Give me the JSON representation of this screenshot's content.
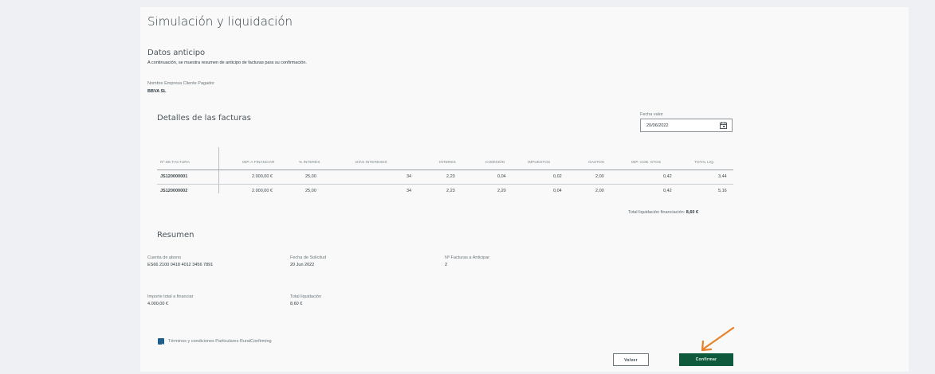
{
  "page": {
    "title": "Simulación y liquidación",
    "datos_anticipo": {
      "heading": "Datos anticipo",
      "intro": "A continuación, se muestra resumen de anticipo de facturas para su confirmación.",
      "empresa_label": "Nombre Empresa Cliente Pagador",
      "empresa_value": "BBVA SL"
    },
    "facturas": {
      "heading": "Detalles de las facturas",
      "fecha_valor_label": "Fecha valor",
      "fecha_valor_value": "20/06/2022",
      "columns": [
        "Nº DE FACTURA",
        "IMP. A FINANCIAR",
        "% INTERÉS",
        "DÍAS INTERESES",
        "INTERES",
        "COMISIÓN",
        "IMPUESTOS",
        "GASTOS",
        "IMP. COB. GTOS",
        "TOTAL LIQ."
      ],
      "rows": [
        [
          "JS120000001",
          "2.000,00 €",
          "25,00",
          "34",
          "2,23",
          "0,04",
          "0,02",
          "2,00",
          "0,42",
          "3,44"
        ],
        [
          "JS120000002",
          "2.000,00 €",
          "25,00",
          "34",
          "2,23",
          "2,20",
          "0,04",
          "2,00",
          "0,42",
          "5,16"
        ]
      ],
      "total_label": "Total liquidación financiación:",
      "total_value": "8,60 €"
    },
    "resumen": {
      "heading": "Resumen",
      "cuenta_label": "Cuenta de abono",
      "cuenta_value": "ES66 2100 0418 4012 3456 7891",
      "fecha_solicitud_label": "Fecha de Solicitud",
      "fecha_solicitud_value": "20 Jun 2022",
      "num_facturas_label": "Nº Facturas a Anticipar",
      "num_facturas_value": "2",
      "importe_label": "Importe total a financiar",
      "importe_value": "4.000,00 €",
      "total_liq_label": "Total liquidación",
      "total_liq_value": "8,60 €"
    },
    "terms_label": "Términos y condiciones Particulares RuralConfirming",
    "buttons": {
      "volver": "Volver",
      "confirmar": "Confirmar"
    },
    "colors": {
      "accent": "#0f5a3d",
      "checkbox": "#1f5f8b",
      "annotation_arrow": "#e8822a"
    }
  }
}
